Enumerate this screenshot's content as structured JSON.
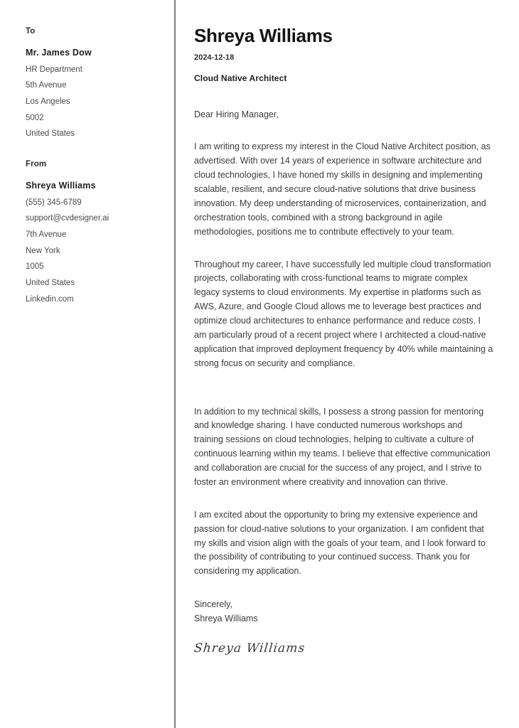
{
  "document": {
    "type": "cover-letter"
  },
  "sidebar": {
    "to": {
      "label": "To",
      "name": "Mr. James Dow",
      "lines": [
        "HR Department",
        "5th Avenue",
        "Los Angeles",
        "5002",
        "United States"
      ]
    },
    "from": {
      "label": "From",
      "name": "Shreya  Williams",
      "lines": [
        "(555) 345-6789",
        "support@cvdesigner.ai",
        "7th Avenue",
        "New York",
        "1005",
        "United States",
        "Linkedin.com"
      ]
    }
  },
  "letter": {
    "name": "Shreya Williams",
    "date": "2024-12-18",
    "role": "Cloud Native Architect",
    "salutation": "Dear Hiring Manager,",
    "paragraphs": [
      "I am writing to express my interest in the Cloud Native Architect position, as advertised. With over 14 years of experience in software architecture and cloud technologies, I have honed my skills in designing and implementing scalable, resilient, and secure cloud-native solutions that drive business innovation. My deep understanding of microservices, containerization, and orchestration tools, combined with a strong background in agile methodologies, positions me to contribute effectively to your team.",
      "Throughout my career, I have successfully led multiple cloud transformation projects, collaborating with cross-functional teams to migrate complex legacy systems to cloud environments. My expertise in platforms such as AWS, Azure, and Google Cloud allows me to leverage best practices and optimize cloud architectures to enhance performance and reduce costs. I am particularly proud of a recent project where I architected a cloud-native application that improved deployment frequency by 40% while maintaining a strong focus on security and compliance.",
      "In addition to my technical skills, I possess a strong passion for mentoring and knowledge sharing. I have conducted numerous workshops and training sessions on cloud technologies, helping to cultivate a culture of continuous learning within my teams. I believe that effective communication and collaboration are crucial for the success of any project, and I strive to foster an environment where creativity and innovation can thrive.",
      "I am excited about the opportunity to bring my extensive experience and passion for cloud-native solutions to your organization. I am confident that my skills and vision align with the goals of your team, and I look forward to the possibility of contributing to your continued success. Thank you for considering my application."
    ],
    "closing": "Sincerely,",
    "closing_name": "Shreya Williams",
    "signature": "Shreya Williams"
  },
  "colors": {
    "divider": "#808080",
    "text": "#3b3b3b",
    "heading": "#141414",
    "page_background": "#ffffff"
  }
}
